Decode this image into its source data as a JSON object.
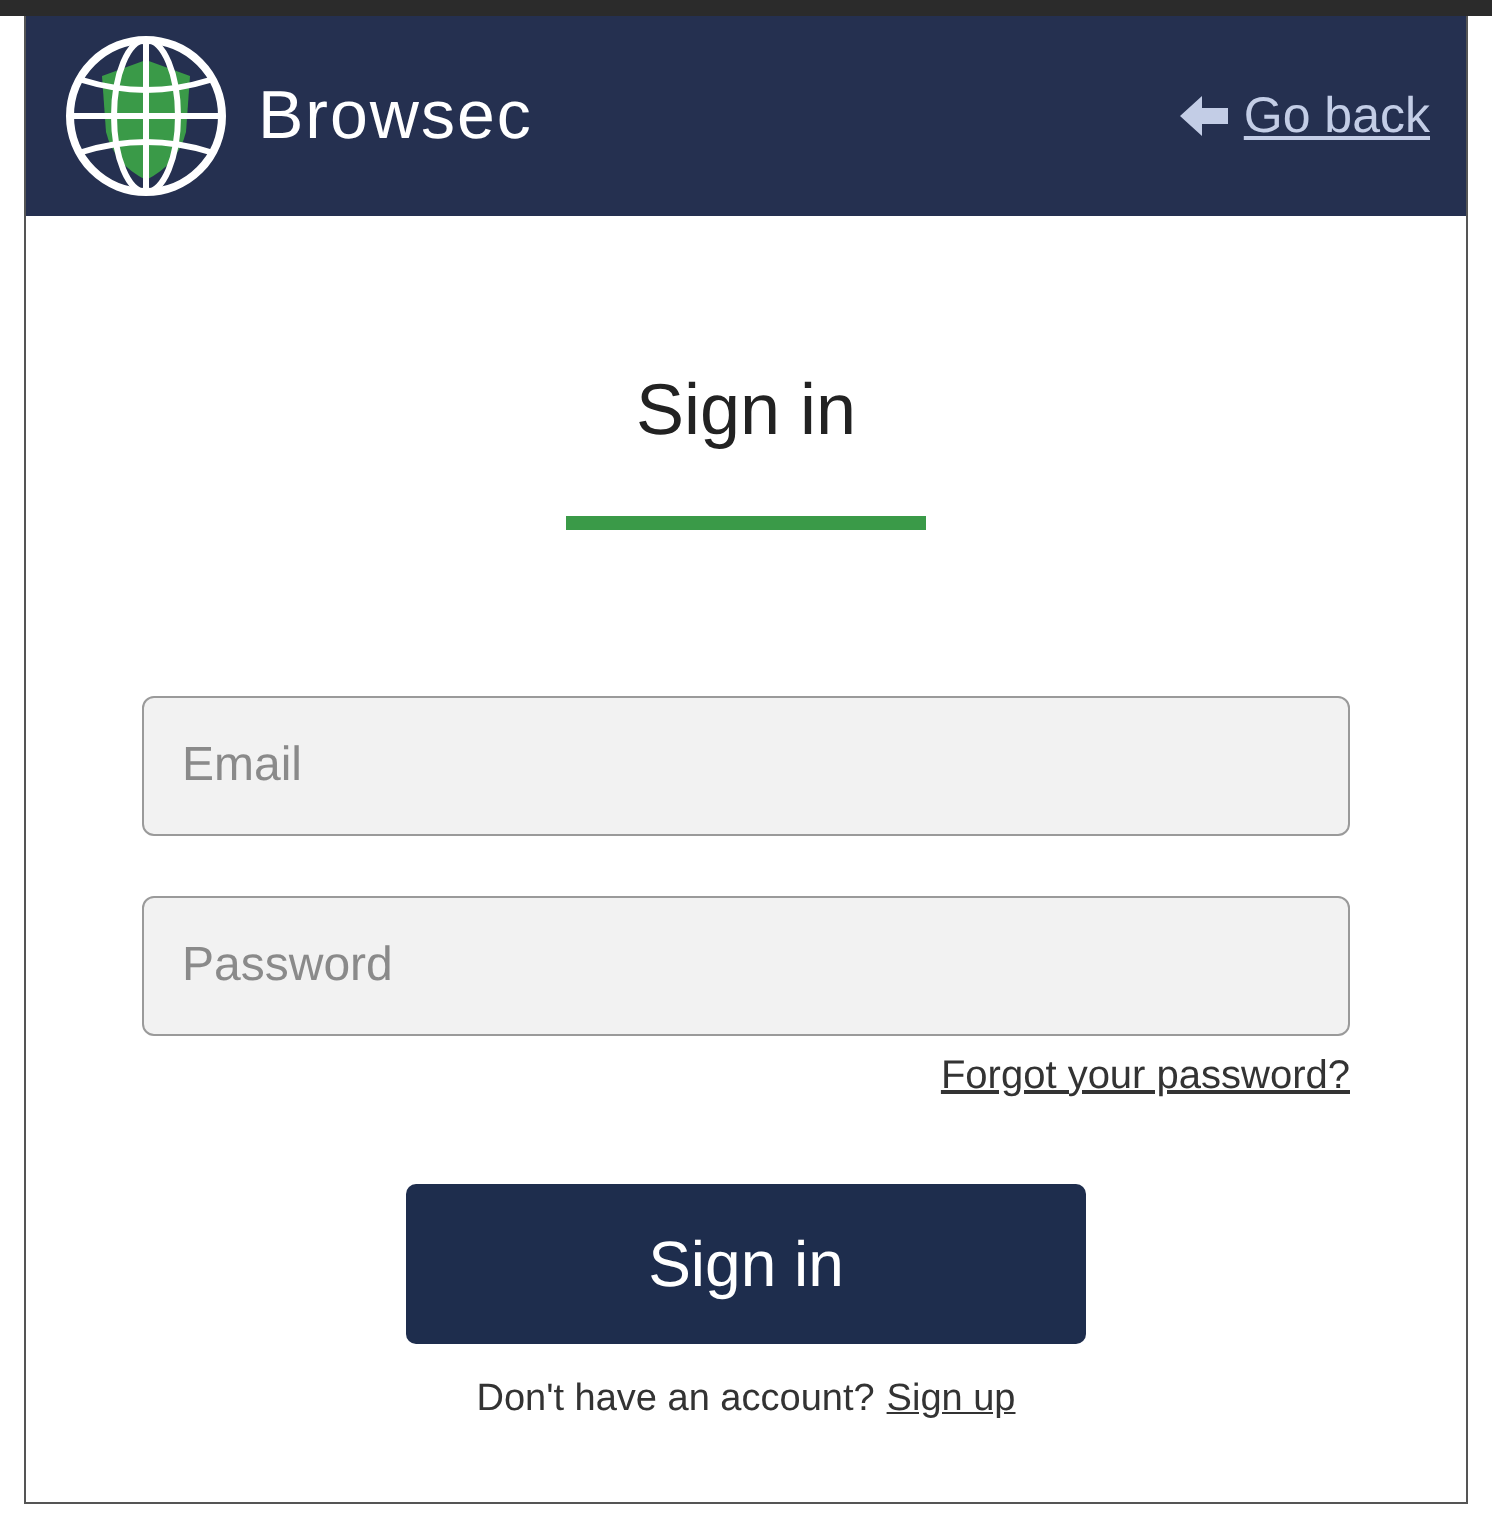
{
  "header": {
    "title": "Browsec",
    "back_link": {
      "label": "Go back"
    }
  },
  "heading": "Sign in",
  "fields": [
    {
      "placeholder": "Email"
    },
    {
      "placeholder": "Password"
    }
  ],
  "forgot_link": "Forgot your password?",
  "submit_button": "Sign in",
  "footer": {
    "text": "Don't have an account?",
    "link": "Sign up"
  }
}
